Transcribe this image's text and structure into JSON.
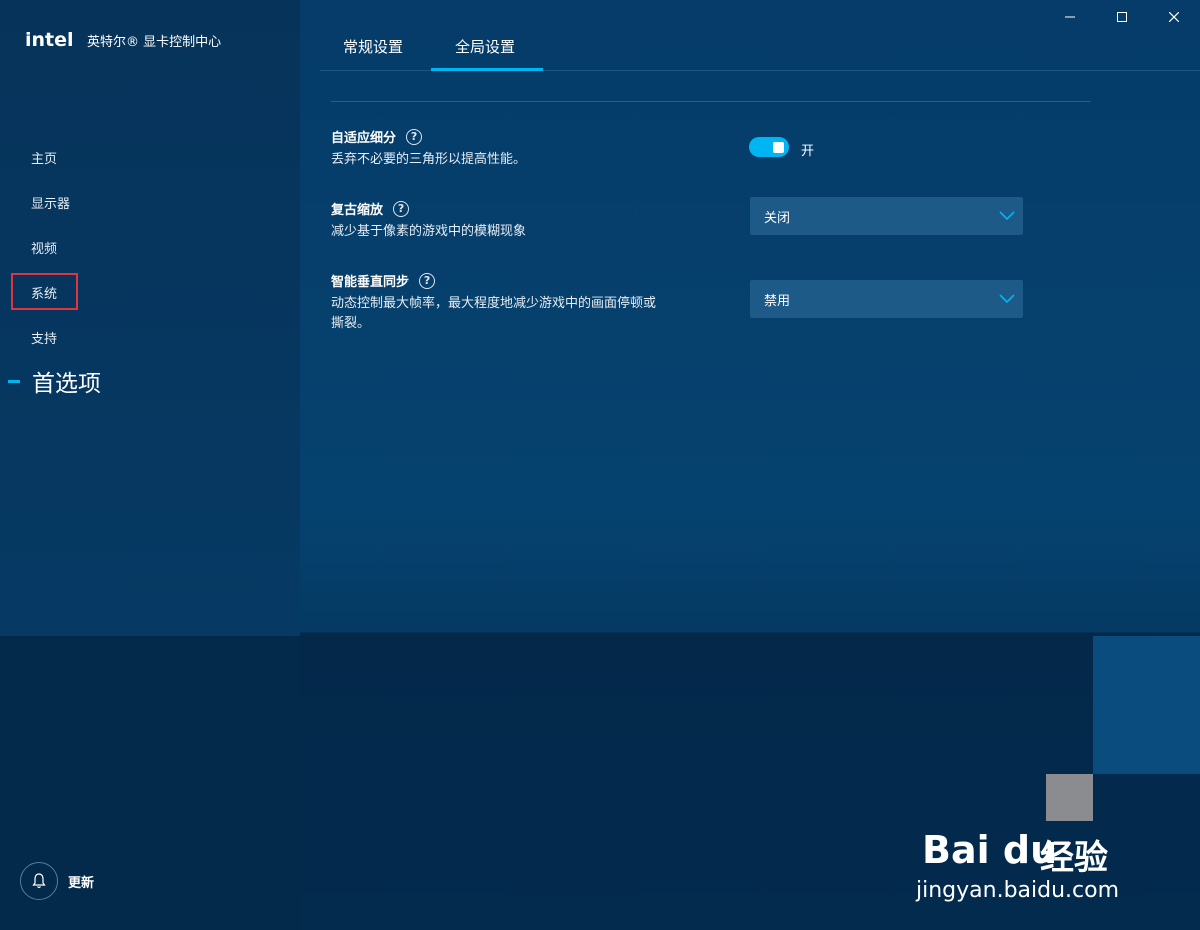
{
  "window": {
    "controls": {
      "minimize": "minimize",
      "maximize": "maximize",
      "close": "close"
    }
  },
  "brand": {
    "logo_text": "intel",
    "title": "英特尔® 显卡控制中心"
  },
  "sidebar": {
    "items": [
      {
        "label": "主页"
      },
      {
        "label": "显示器"
      },
      {
        "label": "视频"
      },
      {
        "label": "系统"
      },
      {
        "label": "支持"
      }
    ],
    "active_item": "首选项",
    "update_label": "更新"
  },
  "tabs": [
    {
      "label": "常规设置",
      "selected": false
    },
    {
      "label": "全局设置",
      "selected": true
    }
  ],
  "settings": [
    {
      "title": "自适应细分",
      "description": "丢弃不必要的三角形以提高性能。",
      "control": "toggle",
      "value": "开",
      "enabled": true
    },
    {
      "title": "复古缩放",
      "description": "减少基于像素的游戏中的模糊现象",
      "control": "dropdown",
      "value": "关闭"
    },
    {
      "title": "智能垂直同步",
      "description_line1": "动态控制最大帧率，最大程度地减少游戏中的画面停顿或",
      "description_line2": "撕裂。",
      "control": "dropdown",
      "value": "禁用"
    }
  ],
  "watermark": {
    "brand": "Bai du",
    "brand_suffix": "经验",
    "url": "jingyan.baidu.com"
  },
  "colors": {
    "accent": "#00b5f1",
    "highlight_box": "#e0343e",
    "dropdown_bg": "#1e5a88"
  }
}
